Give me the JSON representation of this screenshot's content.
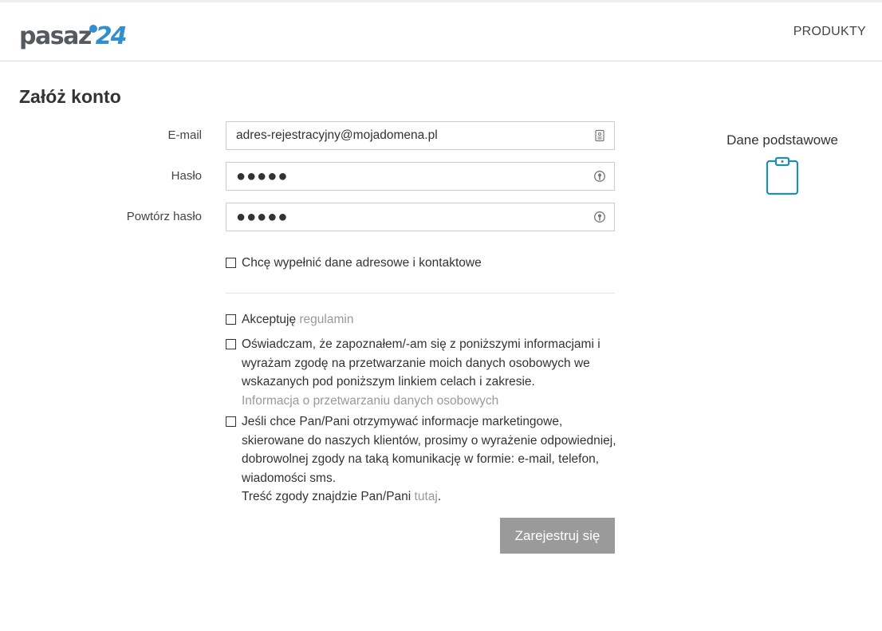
{
  "header": {
    "logo_text": "pasaz",
    "logo_num": "24",
    "nav_products": "PRODUKTY"
  },
  "page": {
    "title": "Załóż konto"
  },
  "form": {
    "email_label": "E-mail",
    "email_value": "adres-rejestracyjny@mojadomena.pl",
    "password_label": "Hasło",
    "password_value": "●●●●●",
    "repeat_label": "Powtórz hasło",
    "repeat_value": "●●●●●"
  },
  "checkboxes": {
    "address": "Chcę wypełnić dane adresowe i kontaktowe",
    "terms_prefix": "Akceptuję ",
    "terms_link": "regulamin",
    "privacy_text": "Oświadczam, że zapoznałem/-am się z poniższymi informacjami i wyrażam zgodę na przetwarzanie moich danych osobowych we wskazanych pod poniższym linkiem celach i zakresie.",
    "privacy_link": "Informacja o przetwarzaniu danych osobowych",
    "marketing_text": "Jeśli chce Pan/Pani otrzymywać informacje marketingowe, skierowane do naszych klientów, prosimy o wyrażenie odpowiedniej, dobrowolnej zgody na taką komunikację w formie: e-mail, telefon, wiadomości sms.",
    "marketing_suffix_prefix": "Treść zgody znajdzie Pan/Pani ",
    "marketing_link": "tutaj",
    "marketing_suffix_end": "."
  },
  "buttons": {
    "submit": "Zarejestruj się"
  },
  "sidebar": {
    "title": "Dane podstawowe",
    "icon": "clipboard-icon"
  },
  "colors": {
    "accent": "#2f8fd0",
    "icon_teal": "#1f8fb0",
    "button_grey": "#9a9a9a",
    "link_grey": "#999999"
  }
}
